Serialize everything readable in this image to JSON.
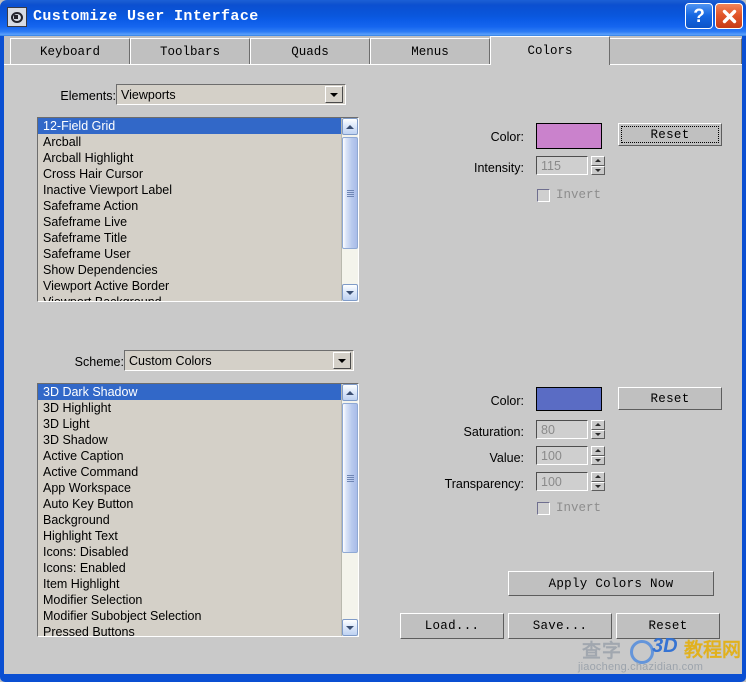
{
  "window": {
    "title": "Customize User Interface",
    "icon": "app-icon",
    "help_button": "?",
    "close_button": "✕"
  },
  "tabs": [
    {
      "label": "Keyboard",
      "selected": false
    },
    {
      "label": "Toolbars",
      "selected": false
    },
    {
      "label": "Quads",
      "selected": false
    },
    {
      "label": "Menus",
      "selected": false
    },
    {
      "label": "Colors",
      "selected": true
    }
  ],
  "elements_section": {
    "label": "Elements:",
    "combo_value": "Viewports",
    "list_items": [
      "12-Field Grid",
      "Arcball",
      "Arcball Highlight",
      "Cross Hair Cursor",
      "Inactive Viewport Label",
      "Safeframe Action",
      "Safeframe Live",
      "Safeframe Title",
      "Safeframe User",
      "Show Dependencies",
      "Viewport Active Border",
      "Viewport Background"
    ],
    "selected_index": 0,
    "color_label": "Color:",
    "color_value": "#CA82CC",
    "reset_label": "Reset",
    "intensity_label": "Intensity:",
    "intensity_value": "115",
    "invert_label": "Invert"
  },
  "scheme_section": {
    "label": "Scheme:",
    "combo_value": "Custom Colors",
    "list_items": [
      "3D Dark Shadow",
      "3D Highlight",
      "3D Light",
      "3D Shadow",
      "Active Caption",
      "Active Command",
      "App Workspace",
      "Auto Key Button",
      "Background",
      "Highlight Text",
      "Icons: Disabled",
      "Icons: Enabled",
      "Item Highlight",
      "Modifier Selection",
      "Modifier Subobject Selection",
      "Pressed Buttons"
    ],
    "selected_index": 0,
    "color_label": "Color:",
    "color_value": "#5A6CC4",
    "reset_label": "Reset",
    "saturation_label": "Saturation:",
    "saturation_value": "80",
    "value_label": "Value:",
    "value_value": "100",
    "transparency_label": "Transparency:",
    "transparency_value": "100",
    "invert_label": "Invert"
  },
  "actions": {
    "apply_colors_now": "Apply Colors Now",
    "load": "Load...",
    "save": "Save...",
    "reset": "Reset"
  },
  "watermark": {
    "cn_left": "查字",
    "brand": "3D",
    "cn_right": "教程网",
    "url": "jiaocheng.chazidian.com"
  }
}
